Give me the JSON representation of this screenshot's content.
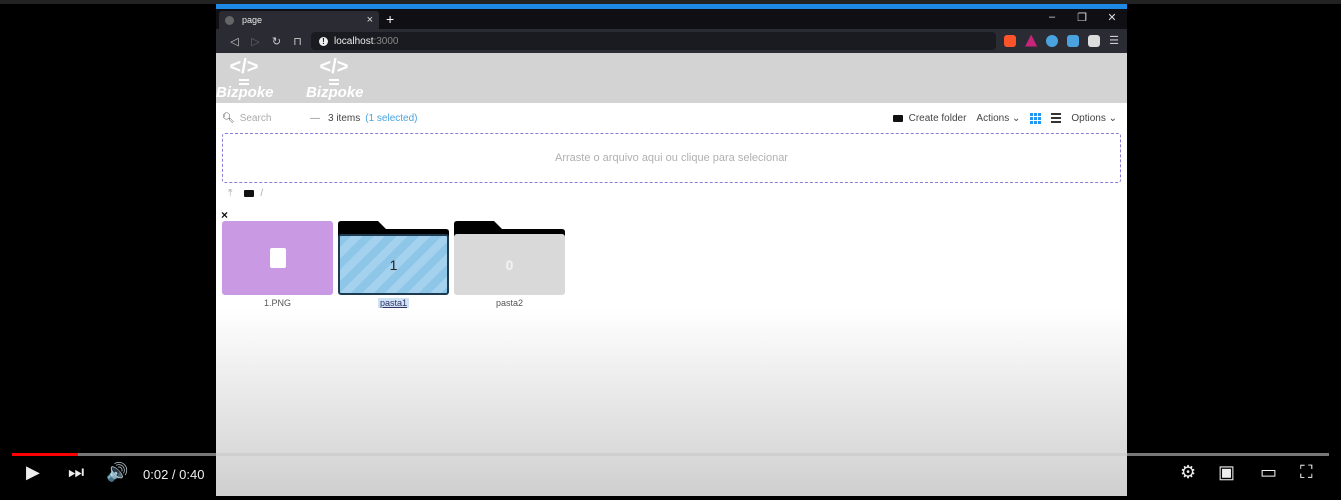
{
  "browser": {
    "tab_title": "page",
    "new_tab": "+",
    "tab_close": "×",
    "window_controls": [
      "–",
      "❐",
      "✕"
    ],
    "nav": [
      "◁",
      "▷",
      "↻",
      "⊓"
    ],
    "url_host": "localhost",
    "url_port": ":3000",
    "extension_colors": [
      "#fb542b",
      "#c8247a",
      "#4aa3df",
      "#4aa3df",
      "#dddddd"
    ]
  },
  "header": {
    "logos": [
      {
        "glyph": "</>",
        "name": "Bizpoke"
      },
      {
        "glyph": "</>",
        "name": "Bizpoke"
      }
    ]
  },
  "toolbar": {
    "search_icon": "search-icon",
    "search_placeholder": "Search",
    "dash": "—",
    "item_count": "3 items",
    "selected_count": "(1 selected)",
    "create_folder": "Create folder",
    "actions": "Actions ⌄",
    "options": "Options ⌄"
  },
  "dropzone": {
    "text": "Arraste o arquivo aqui ou clique para selecionar"
  },
  "breadcrumb": {
    "up": "⤒",
    "path": "/"
  },
  "deselect": "×",
  "items": [
    {
      "name": "1.PNG",
      "type": "file",
      "color": "#c99ae3"
    },
    {
      "name": "pasta1",
      "type": "folder",
      "count": "1",
      "selected": true
    },
    {
      "name": "pasta2",
      "type": "folder",
      "count": "0",
      "selected": false
    }
  ],
  "player": {
    "time": "0:02 / 0:40",
    "progress_fraction": 0.05,
    "progress_color": "#ff0000",
    "play": "▶",
    "next": "⏭",
    "volume": "🔊",
    "settings": "⚙",
    "miniplayer": "▣",
    "theater": "▭",
    "fullscreen": "⛶"
  }
}
